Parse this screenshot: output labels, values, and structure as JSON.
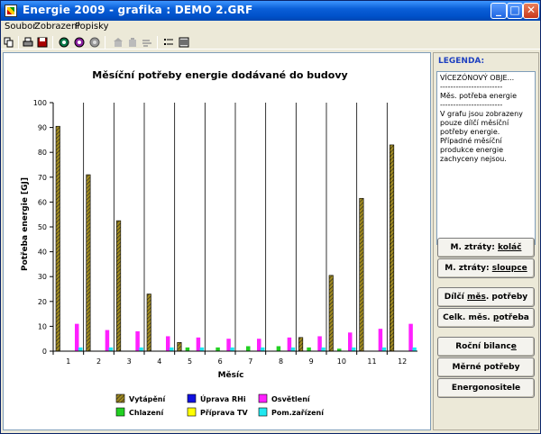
{
  "window": {
    "title": "Energie  2009 - grafika : DEMO 2.GRF",
    "minimize_label": "_",
    "maximize_label": "□",
    "close_label": "✕"
  },
  "menu": {
    "items": [
      "Soubor",
      "Zobrazení",
      "Popisky"
    ]
  },
  "toolbar": {
    "icons": [
      "copy-icon",
      "print-icon",
      "save-icon",
      "graph-1-icon",
      "graph-2-icon",
      "graph-3-icon",
      "building-1-icon",
      "building-2-icon",
      "wind-icon",
      "list-icon",
      "lines-icon"
    ]
  },
  "legend_panel": {
    "title": "LEGENDA:",
    "lines": [
      "VÍCEZÓNOVÝ OBJE...",
      "------------------------",
      "Měs. potřeba energie",
      "------------------------",
      "V grafu jsou zobrazeny pouze dílčí měsíční potřeby energie.",
      "Případné měsíční produkce energie zachyceny nejsou."
    ]
  },
  "buttons": [
    {
      "label_pre": "M. ztráty: ",
      "label_u": "koláč",
      "label_post": ""
    },
    {
      "label_pre": "M. ztráty: ",
      "label_u": "sloupce",
      "label_post": ""
    },
    {
      "label_pre": "Dílčí ",
      "label_u": "měs",
      "label_post": ". potřeby"
    },
    {
      "label_pre": "Celk. měs. ",
      "label_u": "p",
      "label_post": "otřeba"
    },
    {
      "label_pre": "Roční bilanc",
      "label_u": "e",
      "label_post": ""
    },
    {
      "label_pre": "Měrné potřeby",
      "label_u": "",
      "label_post": ""
    },
    {
      "label_pre": "Energonositele",
      "label_u": "",
      "label_post": ""
    }
  ],
  "colors": {
    "heating": "#a08a20",
    "cooling": "#22d022",
    "humidity": "#1010e0",
    "hot_water": "#ffff00",
    "lighting": "#ff20ff",
    "appliances": "#20e8f0"
  },
  "chart_data": {
    "type": "bar",
    "title": "Měsíční potřeby energie dodávané do budovy",
    "xlabel": "Měsíc",
    "ylabel": "Potřeba energie [GJ]",
    "ylim": [
      0,
      100
    ],
    "yticks": [
      0,
      10,
      20,
      30,
      40,
      50,
      60,
      70,
      80,
      90,
      100
    ],
    "categories": [
      "1",
      "2",
      "3",
      "4",
      "5",
      "6",
      "7",
      "8",
      "9",
      "10",
      "11",
      "12"
    ],
    "grid": "vertical",
    "legend_position": "bottom",
    "series": [
      {
        "name": "Vytápění",
        "color_key": "heating",
        "hatched": true,
        "values": [
          90.5,
          71,
          52.5,
          23,
          3.5,
          0,
          0,
          0,
          5.5,
          30.5,
          61.5,
          83
        ]
      },
      {
        "name": "Chlazení",
        "color_key": "cooling",
        "values": [
          0,
          0,
          0,
          0,
          1.5,
          1.5,
          2,
          2,
          1.5,
          1,
          0,
          0
        ]
      },
      {
        "name": "Úprava RHi",
        "color_key": "humidity",
        "values": [
          0,
          0,
          0,
          0,
          0,
          0,
          0,
          0,
          0,
          0,
          0,
          0
        ]
      },
      {
        "name": "Příprava TV",
        "color_key": "hot_water",
        "values": [
          0,
          0,
          0,
          0,
          0,
          0,
          0,
          0,
          0,
          0,
          0,
          0
        ]
      },
      {
        "name": "Osvětlení",
        "color_key": "lighting",
        "values": [
          11,
          8.5,
          8,
          6,
          5.5,
          5,
          5,
          5.5,
          6,
          7.5,
          9,
          11
        ]
      },
      {
        "name": "Pom.zařízení",
        "color_key": "appliances",
        "values": [
          1.5,
          1.5,
          1.5,
          1.5,
          1.5,
          1.5,
          1.5,
          1.5,
          1.5,
          1.5,
          1.5,
          1.5
        ]
      }
    ]
  }
}
